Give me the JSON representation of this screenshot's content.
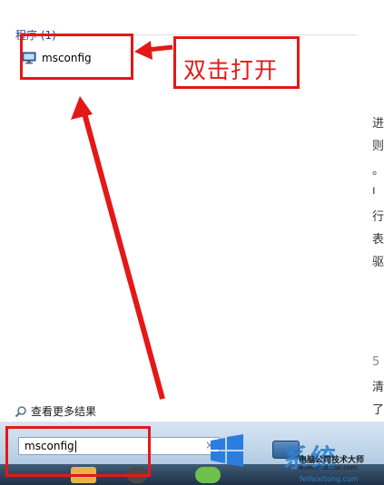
{
  "start_menu": {
    "group_header": "程序 (1)",
    "results": [
      {
        "label": "msconfig",
        "icon": "computer-monitor-icon"
      }
    ],
    "see_more_results": "查看更多结果"
  },
  "search": {
    "value": "msconfig",
    "clear_glyph": "×"
  },
  "annotation": {
    "text": "双击打开",
    "color": "#e51717"
  },
  "background_article": {
    "fragments": [
      "进",
      "则",
      "。",
      "ı",
      "行的",
      "表",
      "驱",
      "5",
      "清",
      "了"
    ]
  },
  "watermark": {
    "brand": "系统",
    "company": "电脑公司技术大师",
    "url": "www.dndadai.com",
    "url2": "feifeixitong.com"
  }
}
